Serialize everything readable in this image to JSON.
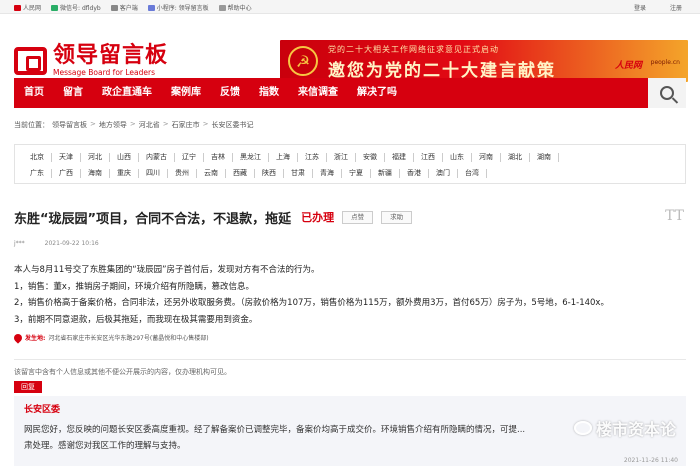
{
  "topbar": {
    "links": [
      {
        "label": "人民网",
        "icon": "people-daily-icon",
        "color": "#d6000f"
      },
      {
        "label": "微信号: dfldyb",
        "icon": "wechat-icon",
        "color": "#2aae67"
      },
      {
        "label": "客户端",
        "icon": "phone-icon",
        "color": "#888888"
      },
      {
        "label": "小程序: 领导留言板",
        "icon": "mini-program-icon",
        "color": "#6a7bd8"
      },
      {
        "label": "帮助中心",
        "icon": "help-icon",
        "color": "#999999"
      }
    ],
    "login": "登录",
    "register": "注册"
  },
  "logo": {
    "cn": "领导留言板",
    "en": "Message Board for Leaders"
  },
  "banner": {
    "sub": "党的二十大相关工作网络征求意见正式启动",
    "main": "邀您为党的二十大建言献策",
    "brand": "人民网",
    "brand2": "people.cn"
  },
  "nav": {
    "items": [
      "首页",
      "留言",
      "政企直通车",
      "案例库",
      "反馈",
      "指数",
      "来信调查",
      "解决了吗"
    ]
  },
  "breadcrumb": {
    "prefix": "当前位置：",
    "items": [
      "领导留言板",
      "地方领导",
      "河北省",
      "石家庄市",
      "长安区委书记"
    ]
  },
  "regions": {
    "row1": [
      "北京",
      "天津",
      "河北",
      "山西",
      "内蒙古",
      "辽宁",
      "吉林",
      "黑龙江",
      "上海",
      "江苏",
      "浙江",
      "安徽",
      "福建",
      "江西",
      "山东",
      "河南",
      "湖北",
      "湖南"
    ],
    "row2": [
      "广东",
      "广西",
      "海南",
      "重庆",
      "四川",
      "贵州",
      "云南",
      "西藏",
      "陕西",
      "甘肃",
      "青海",
      "宁夏",
      "新疆",
      "香港",
      "澳门",
      "台湾"
    ]
  },
  "post": {
    "title": "东胜“珑辰园”项目，合同不合法，不退款，拖延",
    "status": "已办理",
    "btn_praise": "点赞",
    "btn_help": "求助",
    "tt_icon": "TT",
    "author": "j***",
    "time": "2021-09-22 10:16",
    "body": [
      "本人与8月11号交了东胜集团的“珑辰园”房子首付后，发现对方有不合法的行为。",
      "1，销售：董x，推销房子期间，环境介绍有所隐瞒，篡改信息。",
      "2，销售价格高于备案价格，合同非法，还另外收取服务费。（房款价格为107万，销售价格为115万，额外费用3万，首付65万）房子为，5号地，6-1-140x。",
      "3，前期不同意退款，后极其拖延，而我现在极其需要用到资金。"
    ],
    "location_label": "发生地:",
    "location": "河北省石家庄市长安区光华东路297号(蓄晶悦和中心售楼部)"
  },
  "notice": "该留言中含有个人信息或其他不便公开展示的内容，仅办理机构可见。",
  "reply": {
    "tag": "回复",
    "who": "长安区委",
    "text": [
      "网民您好，您反映的问题长安区委高度重视。经了解备案价已调整完毕，备案价均高于成交价。环境销售介绍有所隐瞒的情况，可提...",
      "肃处理。感谢您对我区工作的理解与支持。"
    ],
    "time": "2021-11-26 11:40",
    "watermark": "楼市资本论"
  }
}
